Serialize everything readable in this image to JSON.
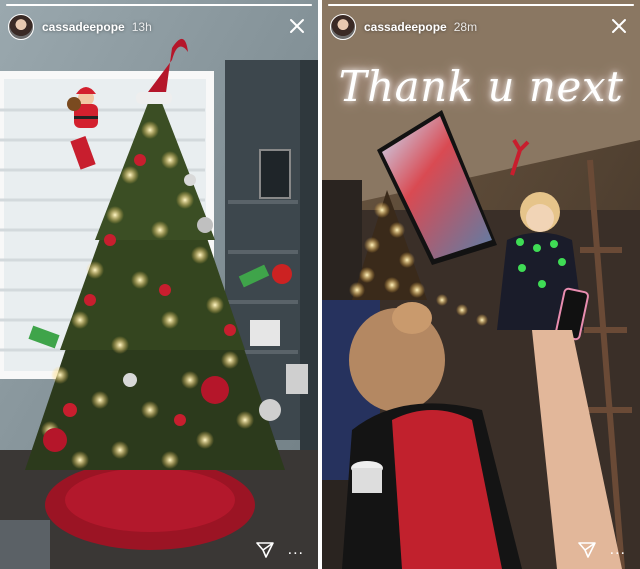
{
  "stories": [
    {
      "username": "cassadeepope",
      "timestamp": "13h",
      "progress": 1.0,
      "icons": {
        "avatar": "avatar",
        "close": "close-icon",
        "send": "send-icon",
        "more": "more-icon"
      }
    },
    {
      "username": "cassadeepope",
      "timestamp": "28m",
      "caption": "Thank u next",
      "progress": 1.0,
      "icons": {
        "avatar": "avatar",
        "close": "close-icon",
        "send": "send-icon",
        "more": "more-icon"
      }
    }
  ],
  "footer": {
    "more_label": "..."
  },
  "colors": {
    "header_text": "#ffffff",
    "caption_glow": "#ffffff",
    "room_wall": "#8c9aa0",
    "tree_green": "#2c3a1c",
    "skirt_red": "#9b1424"
  }
}
